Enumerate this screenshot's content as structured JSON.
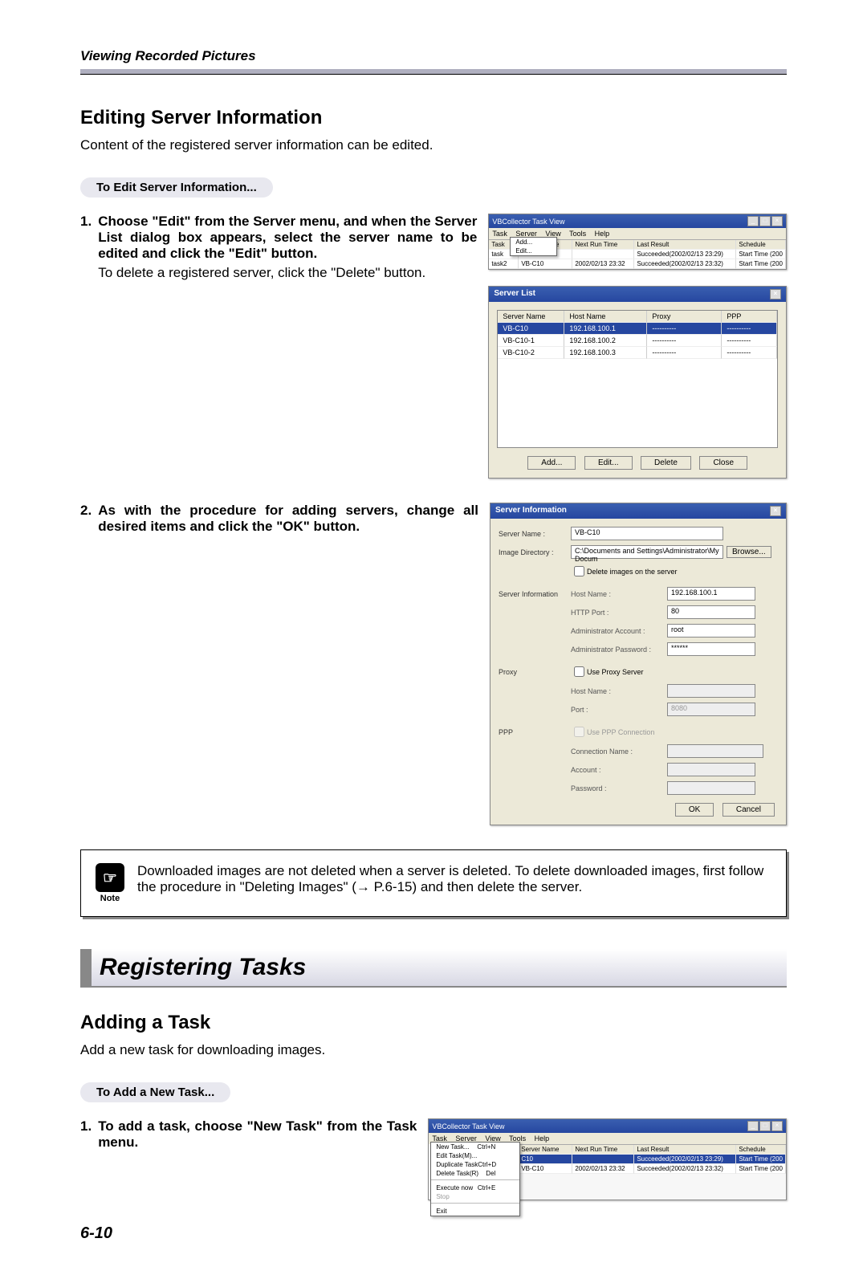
{
  "page": {
    "chapter_header": "Viewing Recorded Pictures",
    "page_number": "6-10"
  },
  "section1": {
    "heading": "Editing Server Information",
    "intro": "Content of the registered server information can be edited.",
    "pill": "To Edit Server Information...",
    "step1": {
      "num": "1.",
      "bold": "Choose \"Edit\" from the Server menu, and when the Server List dialog box appears, select the server name to be edited and click the \"Edit\" button.",
      "normal": "To delete a registered server, click the \"Delete\" button."
    },
    "step2": {
      "num": "2.",
      "bold": "As with the procedure for adding servers, change all desired items and click the \"OK\" button."
    }
  },
  "note": {
    "label": "Note",
    "text": "Downloaded images are not deleted when a server is deleted. To delete downloaded images, first follow the procedure in \"Deleting Images\" (→ P.6-15) and then delete the server."
  },
  "section2": {
    "banner": "Registering Tasks",
    "heading": "Adding a Task",
    "intro": "Add a new task for downloading images.",
    "pill": "To Add a New Task...",
    "step1": {
      "num": "1.",
      "bold": "To add a task, choose \"New Task\" from the Task menu."
    }
  },
  "taskview": {
    "title": "VBCollector Task View",
    "menus": [
      "Task",
      "Server",
      "View",
      "Tools",
      "Help"
    ],
    "cols": {
      "task": "Task",
      "server": "Server Name",
      "nrt": "Next Run Time",
      "lr": "Last Result",
      "sch": "Schedule"
    },
    "server_menu": {
      "add": "Add...",
      "edit": "Edit..."
    },
    "rows": [
      {
        "srv": "VB-C10",
        "nrt": "",
        "lr": "Succeeded(2002/02/13 23:29)",
        "sch": "Start Time (200"
      },
      {
        "srv": "VB-C10",
        "nrt": "2002/02/13 23:32",
        "lr": "Succeeded(2002/02/13 23:32)",
        "sch": "Start Time (200"
      }
    ],
    "task_menu": {
      "new": "New Task...",
      "new_sc": "Ctrl+N",
      "edit": "Edit Task(M)...",
      "dup": "Duplicate Task",
      "dup_sc": "Ctrl+D",
      "del": "Delete Task(R)",
      "del_sc": "Del",
      "exec": "Execute now",
      "exec_sc": "Ctrl+E",
      "stop": "Stop",
      "exit": "Exit"
    },
    "rows2": [
      {
        "srv": "C10",
        "nrt": "",
        "lr": "Succeeded(2002/02/13 23:29)",
        "sch": "Start Time (200"
      },
      {
        "srv": "VB-C10",
        "nrt": "2002/02/13 23:32",
        "lr": "Succeeded(2002/02/13 23:32)",
        "sch": "Start Time (200"
      }
    ]
  },
  "serverlist": {
    "title": "Server List",
    "cols": {
      "name": "Server Name",
      "host": "Host Name",
      "proxy": "Proxy",
      "ppp": "PPP"
    },
    "rows": [
      {
        "name": "VB-C10",
        "host": "192.168.100.1",
        "proxy": "----------",
        "ppp": "----------"
      },
      {
        "name": "VB-C10-1",
        "host": "192.168.100.2",
        "proxy": "----------",
        "ppp": "----------"
      },
      {
        "name": "VB-C10-2",
        "host": "192.168.100.3",
        "proxy": "----------",
        "ppp": "----------"
      }
    ],
    "btns": {
      "add": "Add...",
      "edit": "Edit...",
      "delete": "Delete",
      "close": "Close"
    }
  },
  "serverinfo": {
    "title": "Server Information",
    "labels": {
      "server_name": "Server Name :",
      "image_dir": "Image Directory :",
      "del_images": "Delete images on the server",
      "section": "Server Information",
      "host": "Host Name :",
      "port": "HTTP Port :",
      "admin_acc": "Administrator Account :",
      "admin_pw": "Administrator Password :",
      "proxy": "Proxy",
      "use_proxy": "Use Proxy Server",
      "proxy_host": "Host Name :",
      "proxy_port": "Port :",
      "ppp": "PPP",
      "use_ppp": "Use PPP Connection",
      "conn": "Connection Name :",
      "account": "Account :",
      "password": "Password :"
    },
    "values": {
      "server_name": "VB-C10",
      "image_dir": "C:\\Documents and Settings\\Administrator\\My Docum",
      "host": "192.168.100.1",
      "port": "80",
      "admin_acc": "root",
      "admin_pw": "******",
      "proxy_port": "8080"
    },
    "btns": {
      "browse": "Browse...",
      "ok": "OK",
      "cancel": "Cancel"
    }
  }
}
